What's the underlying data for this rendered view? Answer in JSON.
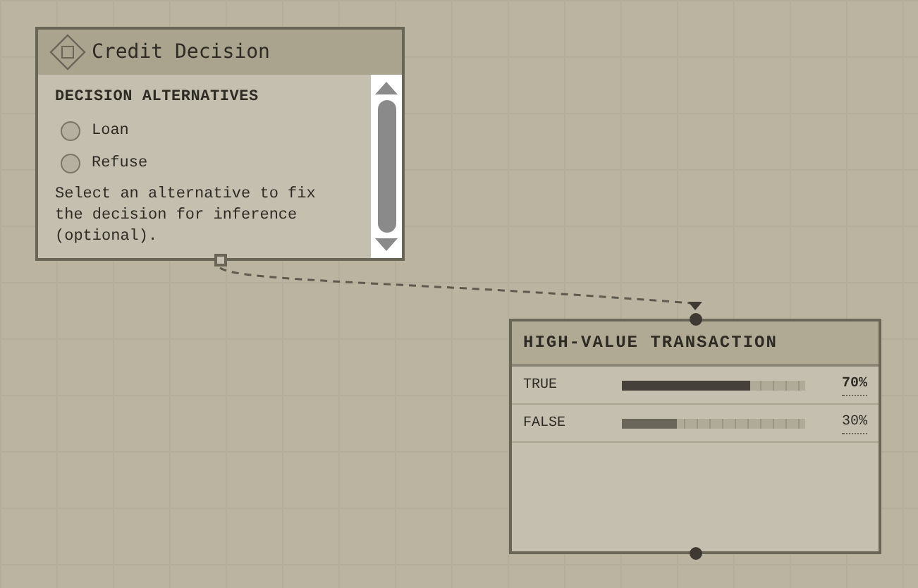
{
  "decision_node": {
    "title": "Credit Decision",
    "section_label": "DECISION ALTERNATIVES",
    "alternatives": [
      {
        "label": "Loan",
        "selected": false
      },
      {
        "label": "Refuse",
        "selected": false
      }
    ],
    "hint": "Select an alternative to fix the decision for inference (optional)."
  },
  "chance_node": {
    "title": "HIGH-VALUE TRANSACTION",
    "states": [
      {
        "label": "TRUE",
        "level": 0.7,
        "reading": "70%",
        "highlighted": true
      },
      {
        "label": "FALSE",
        "level": 0.3,
        "reading": "30%",
        "highlighted": false
      }
    ]
  }
}
